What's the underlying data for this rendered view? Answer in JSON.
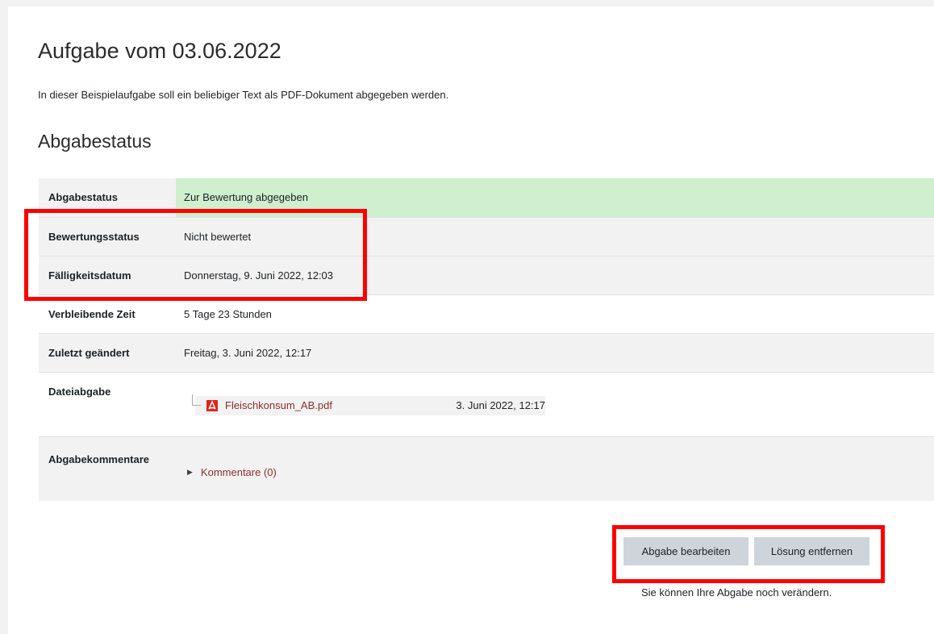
{
  "header": {
    "title": "Aufgabe vom 03.06.2022",
    "intro": "In dieser Beispielaufgabe soll ein beliebiger Text als PDF-Dokument abgegeben werden."
  },
  "status_section": {
    "title": "Abgabestatus",
    "rows": [
      {
        "label": "Abgabestatus",
        "value": "Zur Bewertung abgegeben"
      },
      {
        "label": "Bewertungsstatus",
        "value": "Nicht bewertet"
      },
      {
        "label": "Fälligkeitsdatum",
        "value": "Donnerstag, 9. Juni 2022, 12:03"
      },
      {
        "label": "Verbleibende Zeit",
        "value": "5 Tage 23 Stunden"
      },
      {
        "label": "Zuletzt geändert",
        "value": "Freitag, 3. Juni 2022, 12:17"
      }
    ],
    "file_submission": {
      "label": "Dateiabgabe",
      "file_name": "Fleischkonsum_AB.pdf",
      "file_date": "3. Juni 2022, 12:17",
      "file_icon": "pdf-icon"
    },
    "comments": {
      "label": "Abgabekommentare",
      "link": "Kommentare (0)"
    }
  },
  "actions": {
    "edit_label": "Abgabe bearbeiten",
    "remove_label": "Lösung entfernen",
    "hint": "Sie können Ihre Abgabe noch verändern."
  },
  "colors": {
    "submitted_bg": "#cfefcf",
    "link": "#8b2e2e",
    "highlight": "#ff0000",
    "button_bg": "#ced4da"
  }
}
